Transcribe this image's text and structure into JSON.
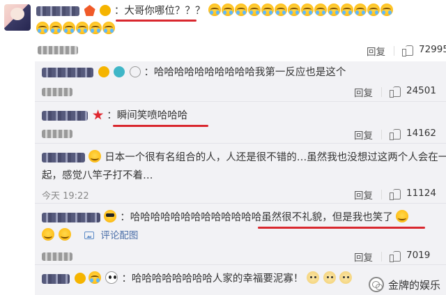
{
  "main_comment": {
    "text": "大哥你哪位？？？",
    "emoji_count_line1": 14,
    "emoji_count_line2": 6,
    "reply_label": "回复",
    "likes": "72995"
  },
  "replies": [
    {
      "text": "：哈哈哈哈哈哈哈哈哈哈我第一反应也是这个",
      "time": "",
      "reply_label": "回复",
      "likes": "24501"
    },
    {
      "text": "瞬间笑喷哈哈哈",
      "time": "",
      "reply_label": "回复",
      "likes": "14162"
    },
    {
      "text_line1": "日本一个很有名组合的人，人还是很不错的…虽然我也没想过这两个人会在一",
      "text_line2": "起，感觉八竿子打不着…",
      "time": "今天 19:22",
      "reply_label": "回复",
      "likes": "11124"
    },
    {
      "text": "：哈哈哈哈哈哈哈哈哈哈哈哈哈虽然很不礼貌，但是我也笑了",
      "comment_pic_label": "评论配图",
      "reply_label": "回复",
      "likes": "7019"
    },
    {
      "text": "：哈哈哈哈哈哈哈哈人家的幸福要泥寡！"
    }
  ],
  "watermark": {
    "text": "金牌的娱乐"
  },
  "colors": {
    "accent_underline": "#d9272e",
    "reply_bg": "#f2f2f5",
    "link": "#4a6ea8"
  }
}
